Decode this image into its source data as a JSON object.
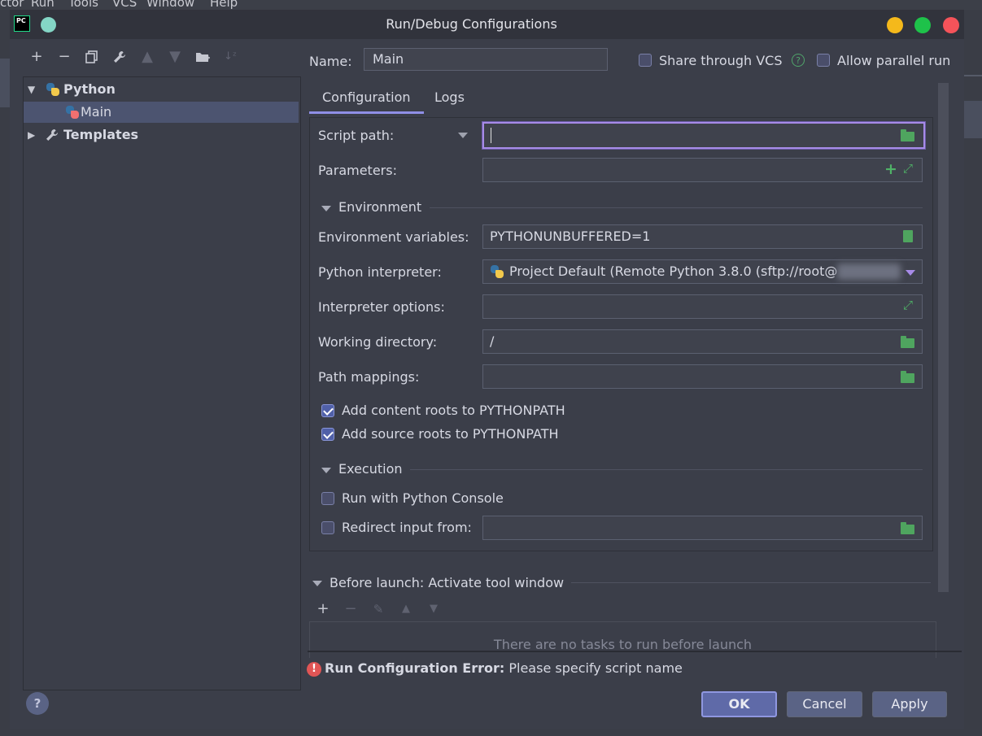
{
  "background_app": {
    "menu_items": [
      "ctor",
      "Run",
      "Tools",
      "VCS",
      "Window",
      "Help"
    ]
  },
  "dialog": {
    "title": "Run/Debug Configurations"
  },
  "left": {
    "toolbar": [
      "add",
      "remove",
      "copy",
      "wrench",
      "move-up",
      "move-down",
      "new-folder",
      "sort"
    ],
    "tree": [
      {
        "label": "Python",
        "expanded": true,
        "bold": true
      },
      {
        "label": "Main",
        "selected": true
      },
      {
        "label": "Templates",
        "expanded": false,
        "bold": true
      }
    ]
  },
  "header": {
    "name_label": "Name:",
    "name_value": "Main",
    "share_label": "Share through VCS",
    "share_help": "?",
    "parallel_label": "Allow parallel run"
  },
  "tabs": [
    {
      "label": "Configuration",
      "active": true
    },
    {
      "label": "Logs",
      "active": false
    }
  ],
  "config": {
    "script_path_label": "Script path:",
    "script_path_value": "",
    "parameters_label": "Parameters:",
    "parameters_value": "",
    "environment_section": "Environment",
    "env_vars_label": "Environment variables:",
    "env_vars_value": "PYTHONUNBUFFERED=1",
    "interpreter_label": "Python interpreter:",
    "interpreter_value": "Project Default (Remote Python 3.8.0 (sftp://root@",
    "interpreter_options_label": "Interpreter options:",
    "interpreter_options_value": "",
    "working_dir_label": "Working directory:",
    "working_dir_value": "/",
    "path_mappings_label": "Path mappings:",
    "path_mappings_value": "",
    "content_roots_label": "Add content roots to PYTHONPATH",
    "content_roots_checked": true,
    "source_roots_label": "Add source roots to PYTHONPATH",
    "source_roots_checked": true,
    "execution_section": "Execution",
    "python_console_label": "Run with Python Console",
    "python_console_checked": false,
    "redirect_input_label": "Redirect input from:",
    "redirect_input_checked": false,
    "redirect_input_value": ""
  },
  "before_launch": {
    "title": "Before launch: Activate tool window",
    "empty_text": "There are no tasks to run before launch"
  },
  "error": {
    "bold": "Run Configuration Error:",
    "message": "Please specify script name"
  },
  "buttons": {
    "ok": "OK",
    "cancel": "Cancel",
    "apply": "Apply",
    "help": "?"
  },
  "colors": {
    "dialog_bg": "#3b3e49",
    "accent_focus": "#a78be8",
    "selection": "#4c5470",
    "error": "#e05555",
    "icon_green": "#4fb267"
  }
}
